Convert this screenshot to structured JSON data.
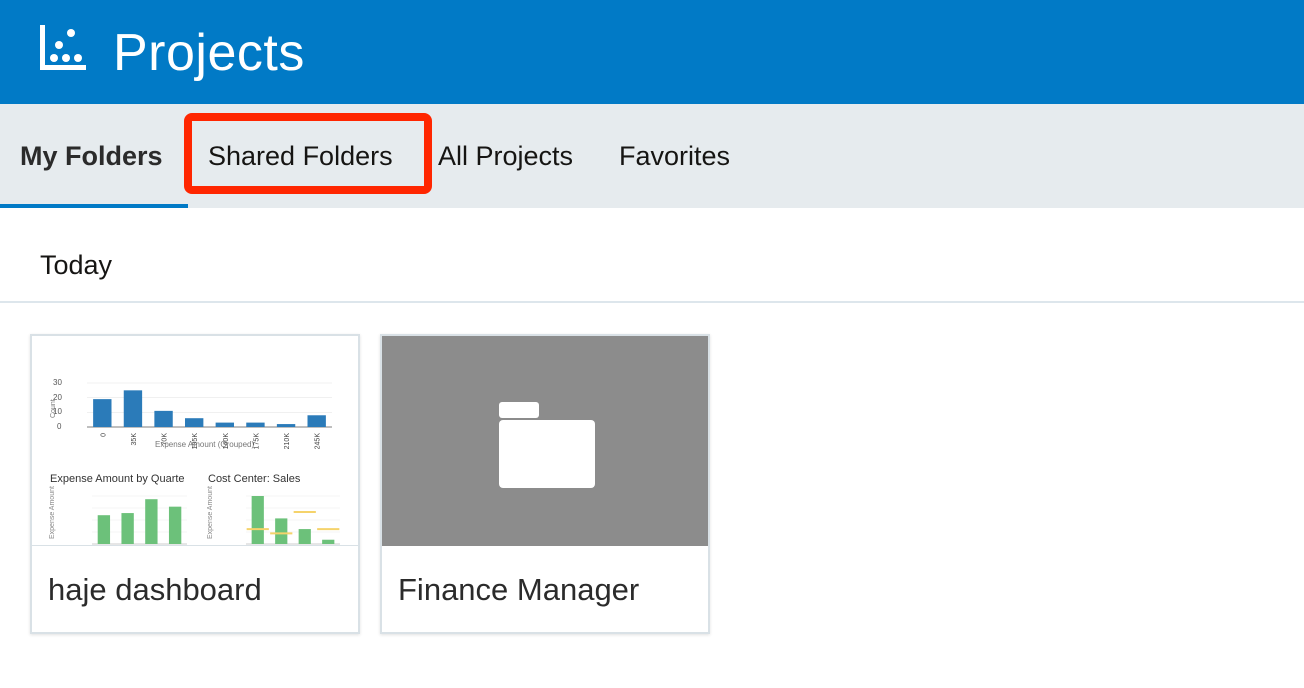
{
  "header": {
    "title": "Projects",
    "logo_icon": "chart-logo-icon"
  },
  "tabs": [
    {
      "label": "My Folders",
      "active": true
    },
    {
      "label": "Shared Folders",
      "active": false,
      "highlighted": true
    },
    {
      "label": "All Projects",
      "active": false
    },
    {
      "label": "Favorites",
      "active": false
    }
  ],
  "section": {
    "label": "Today"
  },
  "cards": [
    {
      "title": "haje dashboard",
      "thumbnail": {
        "top_chart": {
          "type": "bar",
          "y_ticks": [
            "30",
            "20",
            "10",
            "0"
          ],
          "y_label": "Count",
          "x_label": "Expense Amount (Grouped)",
          "categories": [
            "0",
            "35K",
            "70K",
            "105K",
            "140K",
            "175K",
            "210K",
            "245K"
          ],
          "values": [
            19,
            25,
            11,
            6,
            3,
            3,
            2,
            8
          ],
          "ylim": [
            0,
            30
          ],
          "color": "#2b7bb9"
        },
        "left_chart": {
          "title": "Expense Amount by Quarte",
          "y_label": "Expense Amount",
          "values": [
            27,
            29,
            42,
            35
          ],
          "color": "#6cc17a"
        },
        "right_chart": {
          "title": "Cost Center: Sales",
          "y_label": "Expense Amount",
          "values": [
            45,
            24,
            14,
            4
          ],
          "targets": [
            14,
            10,
            30,
            14
          ],
          "color": "#6cc17a",
          "target_color": "#f5d36b"
        }
      }
    },
    {
      "title": "Finance Manager",
      "thumbnail_icon": "folder-icon"
    }
  ],
  "chart_data": [
    {
      "type": "bar",
      "categories": [
        "0",
        "35K",
        "70K",
        "105K",
        "140K",
        "175K",
        "210K",
        "245K"
      ],
      "values": [
        19,
        25,
        11,
        6,
        3,
        3,
        2,
        8
      ],
      "xlabel": "Expense Amount (Grouped)",
      "ylabel": "Count",
      "ylim": [
        0,
        30
      ]
    },
    {
      "type": "bar",
      "title": "Expense Amount by Quarte",
      "ylabel": "Expense Amount",
      "values": [
        27,
        29,
        42,
        35
      ]
    },
    {
      "type": "bar",
      "title": "Cost Center: Sales",
      "ylabel": "Expense Amount",
      "values": [
        45,
        24,
        14,
        4
      ]
    }
  ]
}
